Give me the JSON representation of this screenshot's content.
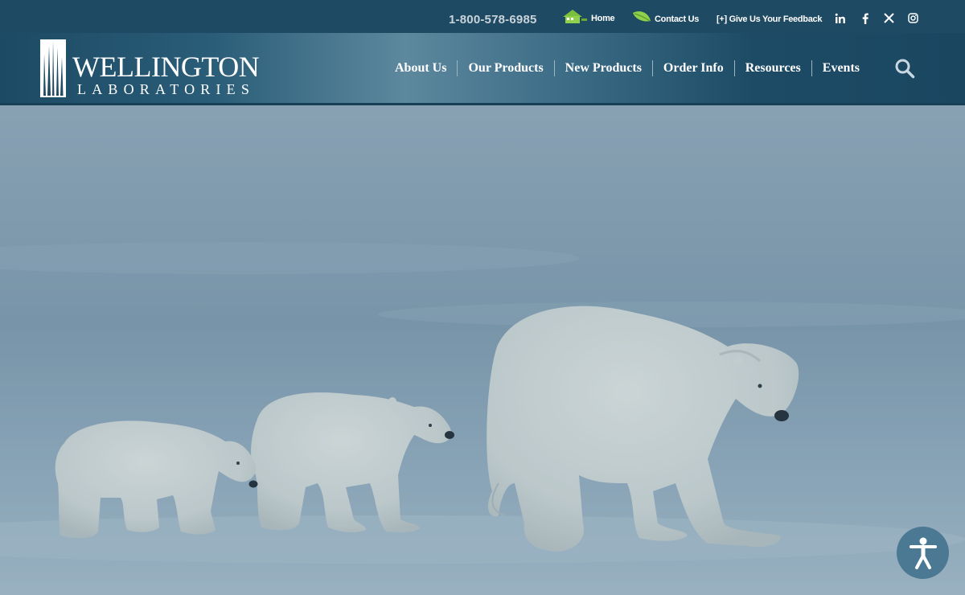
{
  "topbar": {
    "phone": "1-800-578-6985",
    "home_label": "Home",
    "contact_label": "Contact Us",
    "feedback_label": "[+] Give Us Your Feedback",
    "icons": {
      "home": "house-icon",
      "contact": "leaf-icon",
      "linkedin": "linkedin-icon",
      "facebook": "facebook-icon",
      "x": "x-icon",
      "instagram": "instagram-icon"
    }
  },
  "brand": {
    "line1": "WELLINGTON",
    "line2": "LABORATORIES"
  },
  "nav": {
    "items": [
      "About Us",
      "Our Products",
      "New Products",
      "Order Info",
      "Resources",
      "Events"
    ],
    "search_icon": "search-icon"
  },
  "hero": {
    "image": "three polar bears walking on snow",
    "accessibility_icon": "accessibility-icon"
  },
  "colors": {
    "topbar": "#1f4a63",
    "header": "#2a5d78",
    "accent_green": "#7cbf3c",
    "hero_sky": "#8ea4b5"
  }
}
